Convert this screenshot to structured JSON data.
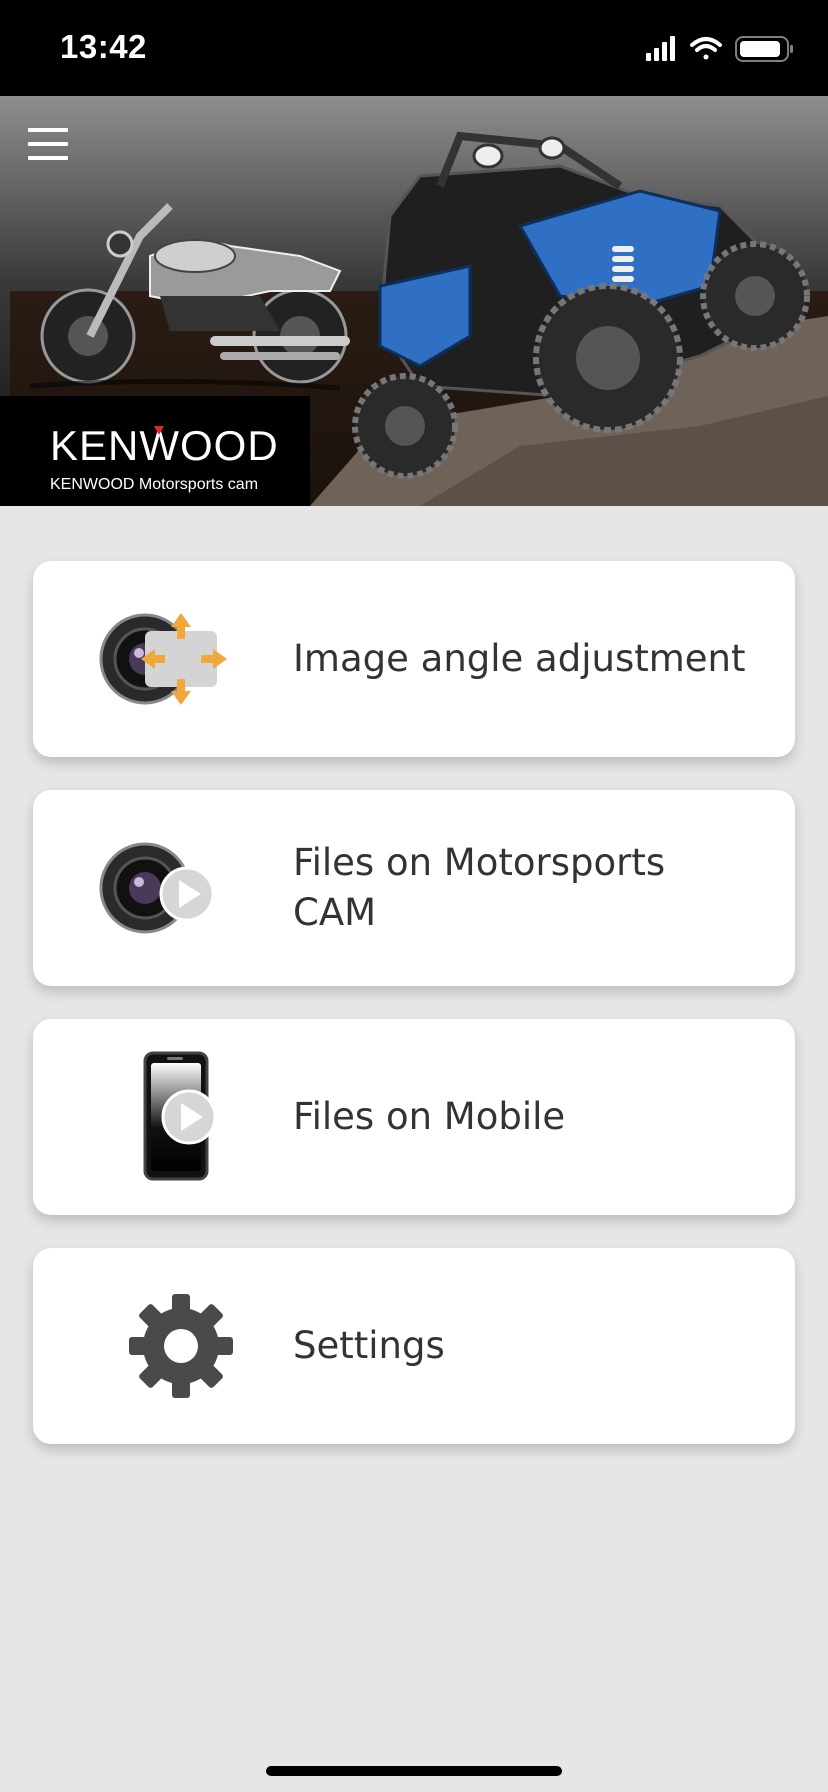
{
  "status_bar": {
    "time": "13:42"
  },
  "header": {
    "menu_icon": "hamburger-menu-icon",
    "brand_logo": "KENWOOD",
    "brand_subtitle": "KENWOOD Motorsports cam",
    "hero_image": "motorcycle and off-road buggy illustration"
  },
  "menu": {
    "items": [
      {
        "label": "Image angle adjustment",
        "icon": "camera-adjust-icon"
      },
      {
        "label": "Files on Motorsports CAM",
        "icon": "camera-play-icon"
      },
      {
        "label": "Files on Mobile",
        "icon": "phone-play-icon"
      },
      {
        "label": "Settings",
        "icon": "gear-icon"
      }
    ]
  },
  "colors": {
    "background": "#e6e6e6",
    "card": "#ffffff",
    "text": "#333333",
    "accent_orange": "#f0a83a",
    "buggy_blue": "#2f6fc4",
    "kenwood_red": "#e0262b"
  }
}
